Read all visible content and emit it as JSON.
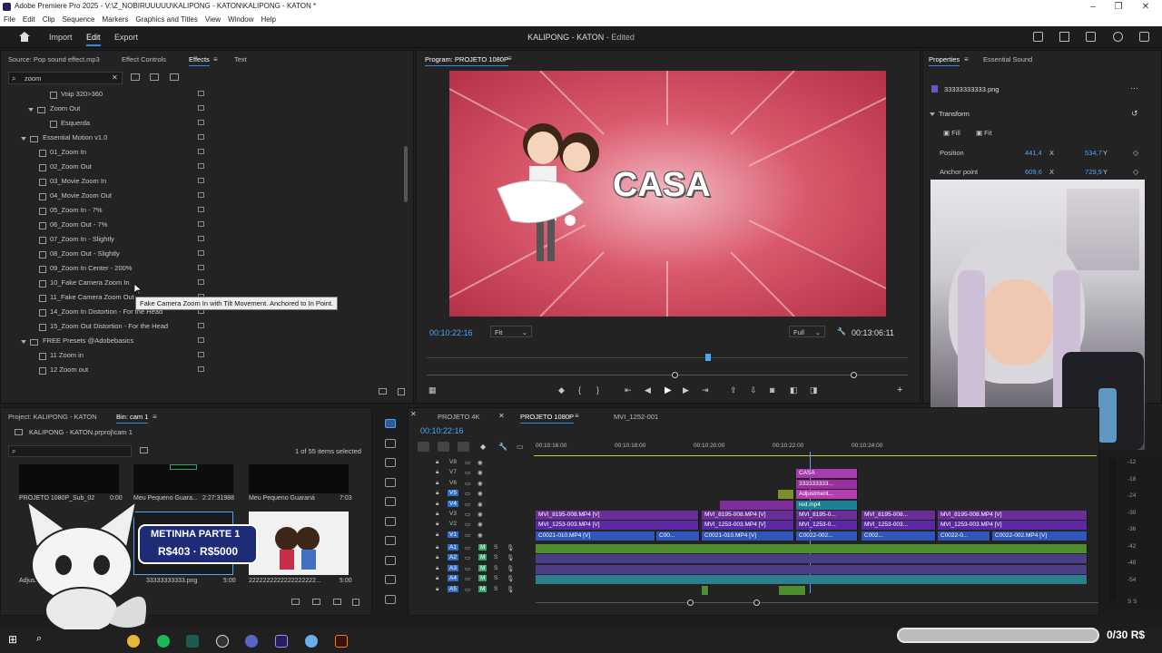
{
  "titlebar": {
    "title": "Adobe Premiere Pro 2025 - V:\\Z_NOBIRUUUUU\\KALIPONG - KATON\\KALIPONG - KATON *"
  },
  "menu": [
    "File",
    "Edit",
    "Clip",
    "Sequence",
    "Markers",
    "Graphics and Titles",
    "View",
    "Window",
    "Help"
  ],
  "header": {
    "nav": [
      "Import",
      "Edit",
      "Export"
    ],
    "active": "Edit",
    "project_title": "KALIPONG - KATON",
    "status": "- Edited"
  },
  "effects_panel": {
    "tabs": [
      "Source: Pop sound effect.mp3",
      "Effect Controls",
      "Effects",
      "Text"
    ],
    "active_tab": "Effects",
    "search_value": "zoom",
    "tree": [
      {
        "label": "Voip 320>360",
        "type": "preset",
        "indent": 3
      },
      {
        "label": "Zoom Out",
        "type": "folder",
        "indent": 2
      },
      {
        "label": "Esquerda",
        "type": "preset",
        "indent": 3
      },
      {
        "label": "Essential Motion v1.0",
        "type": "folder",
        "indent": 1
      },
      {
        "label": "01_Zoom In",
        "type": "preset",
        "indent": 2
      },
      {
        "label": "02_Zoom Out",
        "type": "preset",
        "indent": 2
      },
      {
        "label": "03_Movie Zoom In",
        "type": "preset",
        "indent": 2
      },
      {
        "label": "04_Movie Zoom Out",
        "type": "preset",
        "indent": 2
      },
      {
        "label": "05_Zoom In - 7%",
        "type": "preset",
        "indent": 2
      },
      {
        "label": "06_Zoom Out - 7%",
        "type": "preset",
        "indent": 2
      },
      {
        "label": "07_Zoom In - Slightly",
        "type": "preset",
        "indent": 2
      },
      {
        "label": "08_Zoom Out - Slightly",
        "type": "preset",
        "indent": 2
      },
      {
        "label": "09_Zoom In Center - 200%",
        "type": "preset",
        "indent": 2
      },
      {
        "label": "10_Fake Camera Zoom In",
        "type": "preset",
        "indent": 2
      },
      {
        "label": "11_Fake Camera Zoom Out",
        "type": "preset",
        "indent": 2
      },
      {
        "label": "14_Zoom In Distortion - For the Head",
        "type": "preset",
        "indent": 2
      },
      {
        "label": "15_Zoom Out Distortion - For the Head",
        "type": "preset",
        "indent": 2
      },
      {
        "label": "FREE Presets @Adobebasics",
        "type": "folder",
        "indent": 1
      },
      {
        "label": "11 Zoom in",
        "type": "preset",
        "indent": 2
      },
      {
        "label": "12 Zoom out",
        "type": "preset",
        "indent": 2
      }
    ],
    "tooltip": "Fake Camera Zoom In with Tilt Movement. Anchored to In Point."
  },
  "program_monitor": {
    "title": "Program: PROJETO 1080P",
    "overlay_text": "CASA",
    "current_time": "00:10:22:16",
    "fit": "Fit",
    "quality": "Full",
    "duration": "00:13:06:11"
  },
  "properties": {
    "tabs": [
      "Properties",
      "Essential Sound"
    ],
    "file": "33333333333.png",
    "section": "Transform",
    "fill": "Fill",
    "fit": "Fit",
    "position_label": "Position",
    "position_x": "441,4",
    "position_y": "534,7",
    "anchor_label": "Anchor point",
    "anchor_x": "609,6",
    "anchor_y": "729,9",
    "x_unit": "X",
    "y_unit": "Y"
  },
  "project_panel": {
    "tabs": [
      "Project: KALIPONG - KATON",
      "Bin: cam 1"
    ],
    "path": "KALIPONG - KATON.prproj\\cam 1",
    "selection": "1 of 55 items selected",
    "items": [
      {
        "name": "PROJETO 1080P_Sub_02",
        "duration": "0:00"
      },
      {
        "name": "Meu Pequeno Guara...",
        "duration": "2:27:31988"
      },
      {
        "name": "Meu Pequeno Guaraná",
        "duration": "7:03"
      },
      {
        "name": "Adjustment Layer",
        "duration": ""
      },
      {
        "name": "33333333333.png",
        "duration": "5:00"
      },
      {
        "name": "2222222222222222222...",
        "duration": "5:00"
      }
    ]
  },
  "overlay_badge": {
    "title": "METINHA PARTE 1",
    "amount": "R$403 · R$5000"
  },
  "timeline": {
    "tabs": [
      "PROJETO 4K",
      "PROJETO 1080P",
      "MVI_1252-001"
    ],
    "active_tab": "PROJETO 1080P",
    "timecode": "00:10:22:16",
    "ruler": [
      "00:10:16:00",
      "00:10:18:00",
      "00:10:20:00",
      "00:10:22:00",
      "00:10:24:00"
    ],
    "video_tracks": [
      "V8",
      "V7",
      "V6",
      "V5",
      "V4",
      "V3",
      "V2",
      "V1"
    ],
    "audio_tracks": [
      "A1",
      "A2",
      "A3",
      "A4",
      "A5"
    ],
    "clips": {
      "casa": "CASA",
      "png": "333333333...",
      "adjustment": "Adjustment...",
      "red": "red.mp4",
      "fx": "fx",
      "v3": [
        "MVI_8195-008.MP4 [V]",
        "MVI_8195-008.MP4 [V]",
        "MVI_8195-0...",
        "MVI_8195-008...",
        "MVI_8195-008.MP4 [V]"
      ],
      "v2": [
        "MVI_1253-003.MP4 [V]",
        "MVI_1253-003.MP4 [V]",
        "MVI_1253-0...",
        "MVI_1253-003...",
        "MVI_1253-003.MP4 [V]"
      ],
      "v1": [
        "C0021-010.MP4 [V]",
        "C00...",
        "C0021-010.MP4 [V]",
        "C0022-002...",
        "C002...",
        "C0022-0...",
        "C0022-002.MP4 [V]"
      ]
    },
    "meter_scale": [
      "-12",
      "-18",
      "-24",
      "-30",
      "-36",
      "-42",
      "-48",
      "-54"
    ],
    "meter_footer": "S S"
  },
  "overlay_counter": "0/30 R$"
}
